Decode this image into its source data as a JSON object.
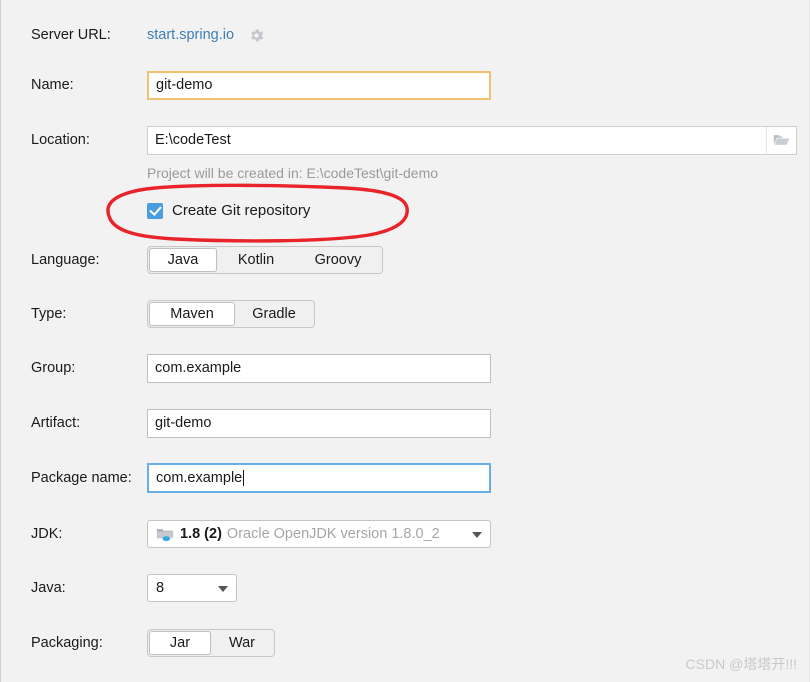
{
  "form": {
    "server_url": {
      "label": "Server URL:",
      "value": "start.spring.io",
      "settings_icon": "gear-icon"
    },
    "name": {
      "label": "Name:",
      "value": "git-demo"
    },
    "location": {
      "label": "Location:",
      "value": "E:\\codeTest",
      "browse_icon": "folder-icon"
    },
    "project_hint": "Project will be created in: E:\\codeTest\\git-demo",
    "git": {
      "label": "Create Git repository",
      "checked": "true"
    },
    "language": {
      "label": "Language:",
      "options": [
        "Java",
        "Kotlin",
        "Groovy"
      ],
      "selected": "Java"
    },
    "type": {
      "label": "Type:",
      "options": [
        "Maven",
        "Gradle"
      ],
      "selected": "Maven"
    },
    "group": {
      "label": "Group:",
      "value": "com.example"
    },
    "artifact": {
      "label": "Artifact:",
      "value": "git-demo"
    },
    "package_name": {
      "label": "Package name:",
      "value": "com.example"
    },
    "jdk": {
      "label": "JDK:",
      "icon": "jdk-folder-icon",
      "version": "1.8 (2)",
      "description": "Oracle OpenJDK version 1.8.0_2"
    },
    "java": {
      "label": "Java:",
      "value": "8"
    },
    "packaging": {
      "label": "Packaging:",
      "options": [
        "Jar",
        "War"
      ],
      "selected": "Jar"
    }
  },
  "annotation": {
    "color": "#e8232a",
    "shape": "ellipse-highlight"
  },
  "watermark": "CSDN @塔塔开!!!",
  "colors": {
    "accent_blue": "#4a9ee0",
    "link": "#3e7eb5",
    "focus": "#6aaee8",
    "amber": "#f0c173",
    "annotation_red": "#e8232a"
  }
}
